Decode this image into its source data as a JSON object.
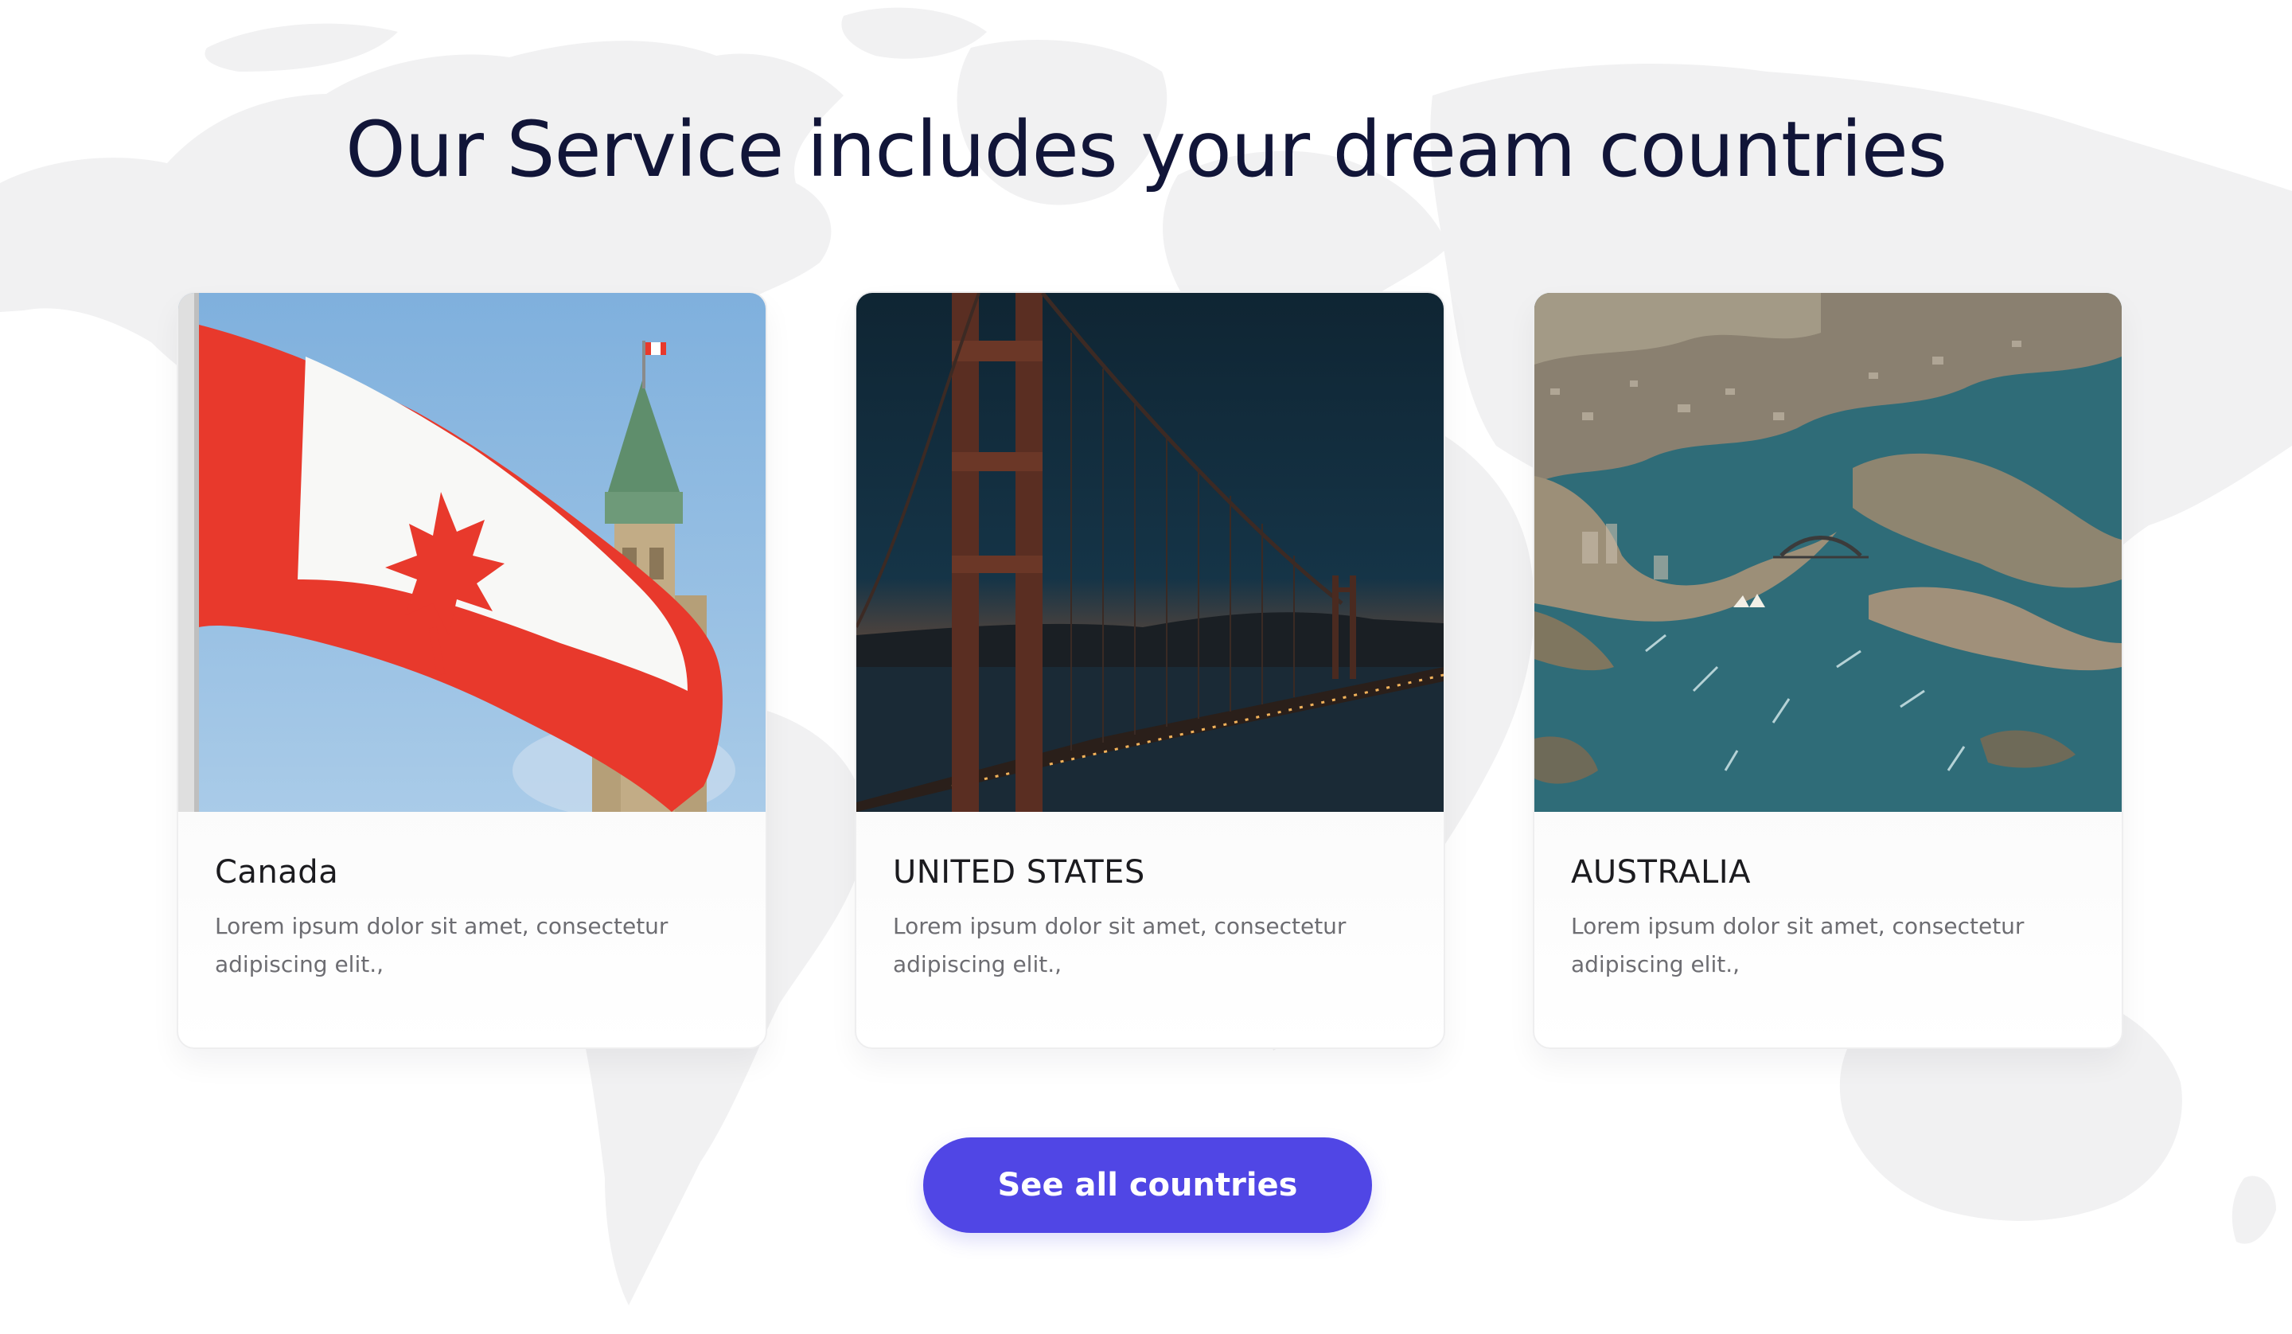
{
  "section": {
    "heading": "Our Service includes your dream countries"
  },
  "countries": [
    {
      "name": "Canada",
      "description": "Lorem ipsum dolor sit amet, consectetur adipiscing elit.,",
      "image": "canada-flag-parliament-photo"
    },
    {
      "name": "UNITED STATES",
      "description": "Lorem ipsum dolor sit amet, consectetur adipiscing elit.,",
      "image": "golden-gate-bridge-night-photo"
    },
    {
      "name": "AUSTRALIA",
      "description": "Lorem ipsum dolor sit amet, consectetur adipiscing elit.,",
      "image": "sydney-harbour-aerial-photo"
    }
  ],
  "cta": {
    "label": "See all countries"
  },
  "colors": {
    "heading": "#111538",
    "button": "#5046e5",
    "button_text": "#ffffff",
    "map": "#f1f1f2"
  },
  "background": "world-map-silhouette"
}
